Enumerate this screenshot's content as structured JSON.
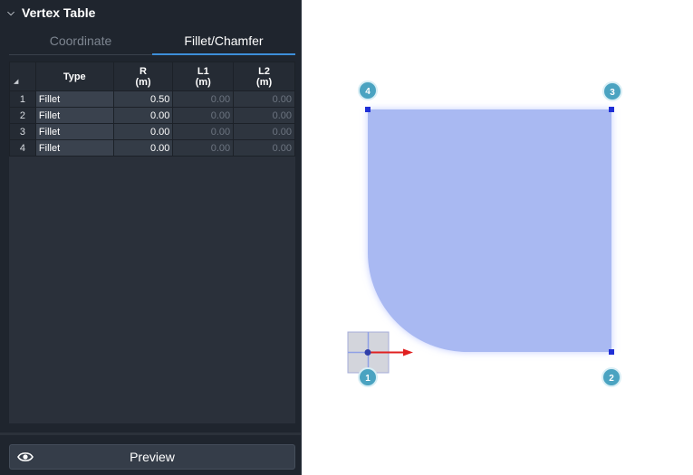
{
  "panel": {
    "title": "Vertex Table",
    "tabs": [
      {
        "label": "Coordinate",
        "active": false
      },
      {
        "label": "Fillet/Chamfer",
        "active": true
      }
    ],
    "table": {
      "headers": {
        "type": "Type",
        "r": "R",
        "r_unit": "(m)",
        "l1": "L1",
        "l1_unit": "(m)",
        "l2": "L2",
        "l2_unit": "(m)"
      },
      "rows": [
        {
          "index": "1",
          "type": "Fillet",
          "r": "0.50",
          "l1": "0.00",
          "l2": "0.00"
        },
        {
          "index": "2",
          "type": "Fillet",
          "r": "0.00",
          "l1": "0.00",
          "l2": "0.00"
        },
        {
          "index": "3",
          "type": "Fillet",
          "r": "0.00",
          "l1": "0.00",
          "l2": "0.00"
        },
        {
          "index": "4",
          "type": "Fillet",
          "r": "0.00",
          "l1": "0.00",
          "l2": "0.00"
        }
      ]
    },
    "preview_label": "Preview"
  },
  "canvas": {
    "vertex_labels": [
      "1",
      "2",
      "3",
      "4"
    ],
    "colors": {
      "shape_fill": "#a9b9f2",
      "badge": "#4aa3c1",
      "axis_x": "#e02020",
      "vertex_handle": "#1f2fd6"
    }
  }
}
